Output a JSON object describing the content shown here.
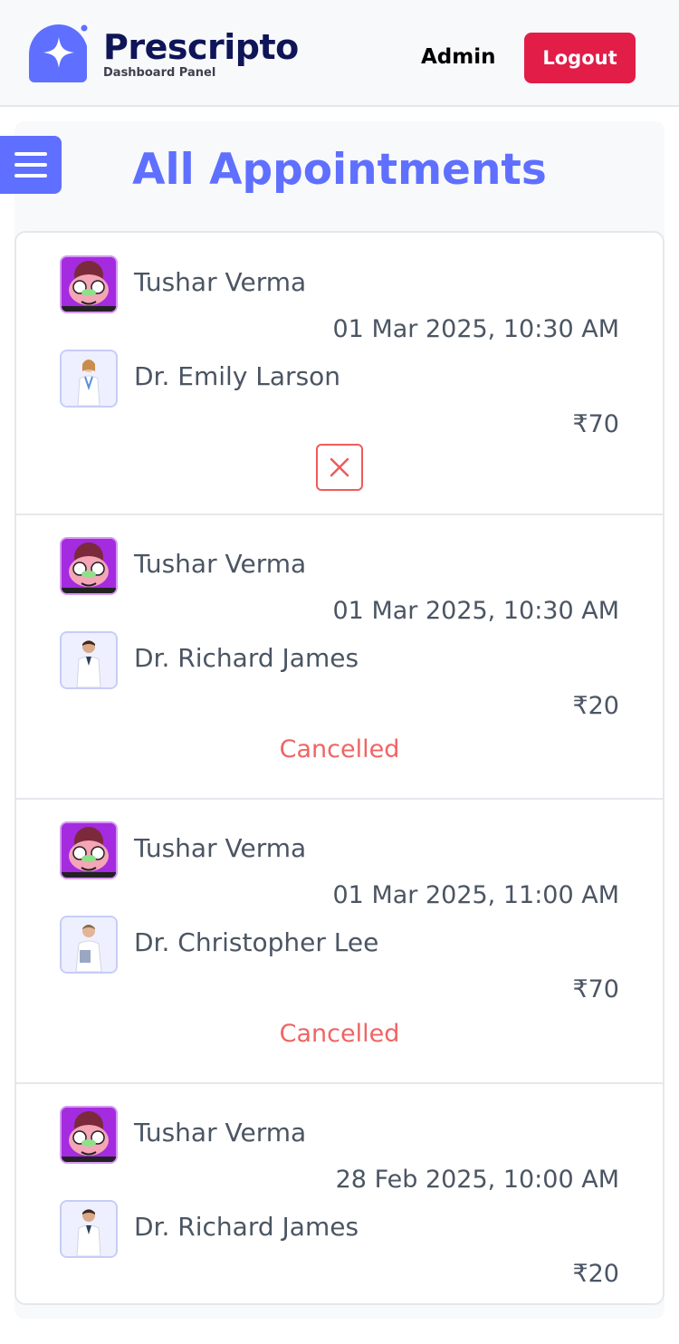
{
  "header": {
    "brand": "Prescripto",
    "subtitle": "Dashboard Panel",
    "role": "Admin",
    "logout_label": "Logout",
    "brand_color": "#0f1557",
    "accent": "#5f6fff",
    "logout_color": "#e11d48"
  },
  "page": {
    "title": "All Appointments",
    "menu_icon": "hamburger-icon"
  },
  "appointments": [
    {
      "patient": "Tushar Verma",
      "datetime": "01 Mar 2025,  10:30 AM",
      "doctor": "Dr. Emily Larson",
      "fee": "₹70",
      "action": "cancel-icon",
      "status": ""
    },
    {
      "patient": "Tushar Verma",
      "datetime": "01 Mar 2025,  10:30 AM",
      "doctor": "Dr. Richard James",
      "fee": "₹20",
      "status": "Cancelled"
    },
    {
      "patient": "Tushar Verma",
      "datetime": "01 Mar 2025,  11:00 AM",
      "doctor": "Dr. Christopher Lee",
      "fee": "₹70",
      "status": "Cancelled"
    },
    {
      "patient": "Tushar Verma",
      "datetime": "28 Feb 2025,  10:00 AM",
      "doctor": "Dr. Richard James",
      "fee": "₹20",
      "status": ""
    }
  ],
  "colors": {
    "cancelled": "#f06464",
    "panel": "#f8f9fb",
    "border": "#e5e7eb"
  }
}
